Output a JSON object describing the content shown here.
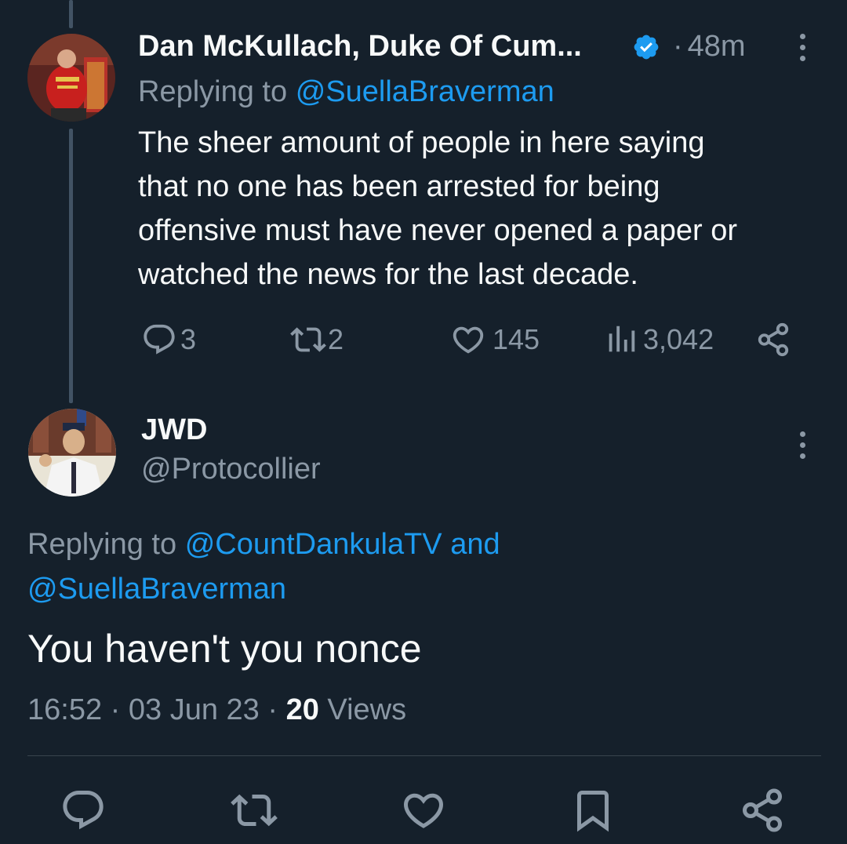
{
  "parent_tweet": {
    "author_name": "Dan McKullach, Duke Of Cum...",
    "separator": "·",
    "time": "48m",
    "replying_prefix": "Replying to",
    "replying_handle": "@SuellaBraverman",
    "text_lines": [
      "The sheer amount of people in here saying",
      "that no one has been arrested for being",
      "offensive must have never opened a paper or",
      "watched the news for the last decade."
    ],
    "replies": "3",
    "retweets": "2",
    "likes": "145",
    "views": "3,042"
  },
  "main_tweet": {
    "author_name": "JWD",
    "handle": "@Protocollier",
    "replying_prefix": "Replying to",
    "replying_handle_1": "@CountDankulaTV",
    "replying_and": "and",
    "replying_handle_2": "@SuellaBraverman",
    "text": "You haven't you nonce",
    "time": "16:52",
    "date": "03 Jun 23",
    "views_count": "20",
    "views_label": "Views"
  },
  "colors": {
    "background": "#15202b",
    "accent": "#1d9bf0",
    "muted": "#8b98a5",
    "text": "#f7f9f9"
  },
  "icons": {
    "verified": "verified-badge-icon",
    "reply": "reply-icon",
    "retweet": "retweet-icon",
    "like": "heart-icon",
    "views": "views-icon",
    "share": "share-icon",
    "bookmark": "bookmark-icon",
    "more": "more-icon"
  }
}
